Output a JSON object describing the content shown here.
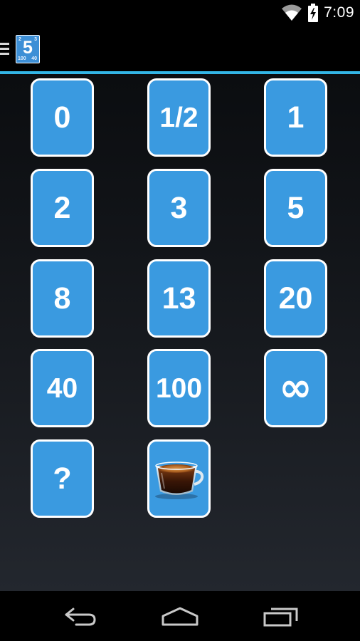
{
  "status_bar": {
    "time": "7:09",
    "icons": [
      "wifi-icon",
      "battery-icon"
    ]
  },
  "action_bar": {
    "menu_icon": "hamburger-icon",
    "logo": {
      "main": "5",
      "corners": [
        "2",
        "3",
        "100",
        "40"
      ]
    },
    "accent_color": "#33b5e5"
  },
  "cards": [
    {
      "label": "0"
    },
    {
      "label": "1/2"
    },
    {
      "label": "1"
    },
    {
      "label": "2"
    },
    {
      "label": "3"
    },
    {
      "label": "5"
    },
    {
      "label": "8"
    },
    {
      "label": "13"
    },
    {
      "label": "20"
    },
    {
      "label": "40"
    },
    {
      "label": "100"
    },
    {
      "label": "∞"
    },
    {
      "label": "?"
    },
    {
      "label": "",
      "icon": "coffee-cup-icon"
    }
  ],
  "card_color": "#3a9ae0",
  "nav_bar": {
    "buttons": [
      "back-icon",
      "home-icon",
      "recent-apps-icon"
    ]
  }
}
